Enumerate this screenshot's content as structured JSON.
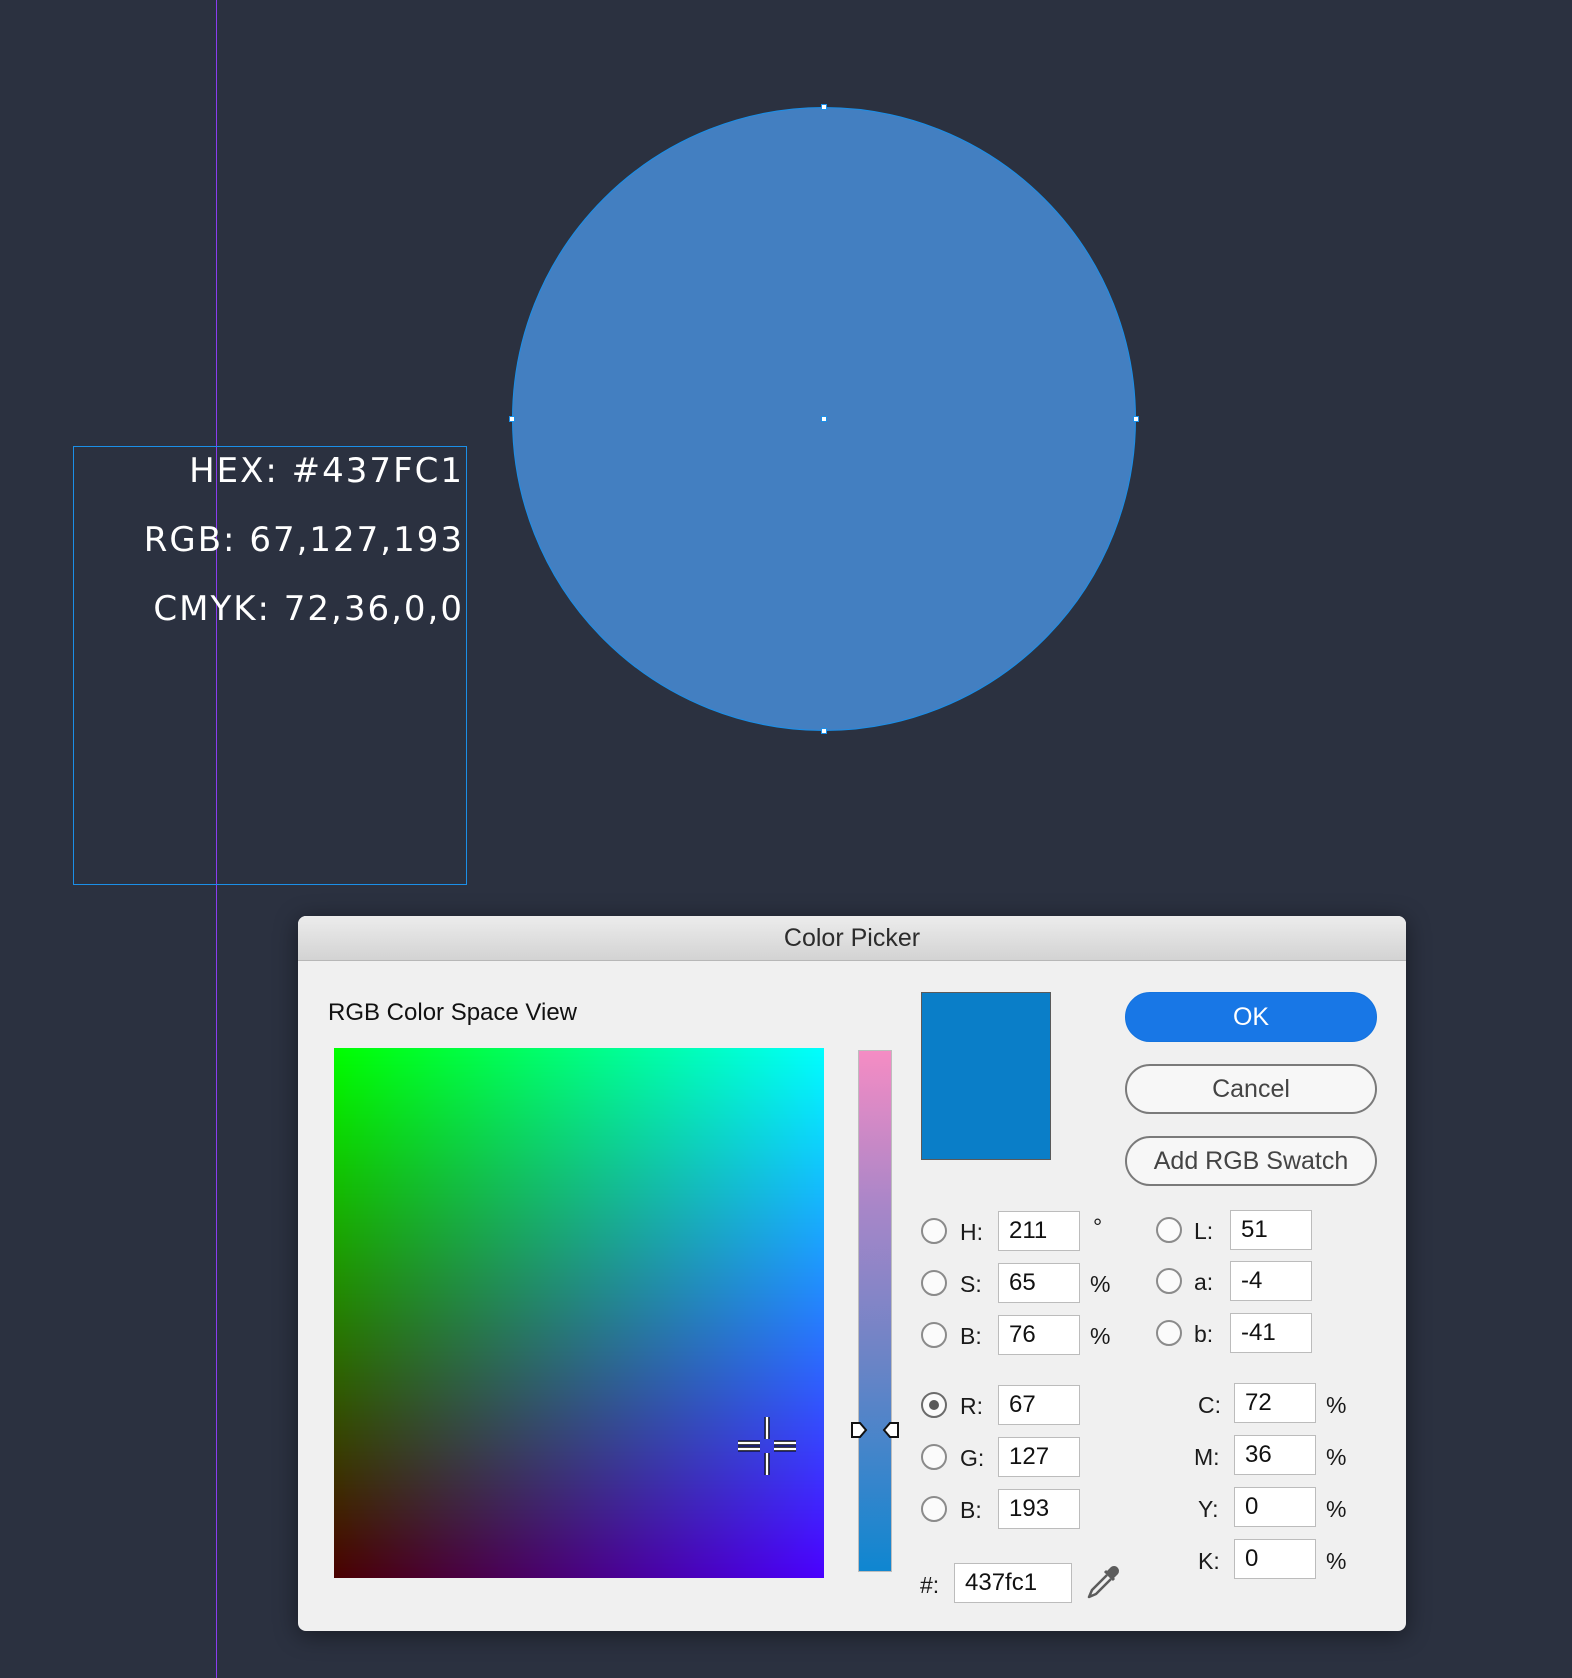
{
  "canvas": {
    "info": {
      "hex": "HEX: #437FC1",
      "rgb": "RGB: 67,127,193",
      "cmyk": "CMYK: 72,36,0,0"
    },
    "circle_color": "#437fc1",
    "guide_color": "#8a3cf0",
    "selection_color": "#1b8fe8"
  },
  "dialog": {
    "title": "Color Picker",
    "view_label": "RGB Color Space View",
    "buttons": {
      "ok": "OK",
      "cancel": "Cancel",
      "add_swatch": "Add RGB Swatch"
    },
    "swatch_color": "#0a7ec8",
    "hsb": [
      {
        "label": "H:",
        "value": "211",
        "unit": "°",
        "selected": false
      },
      {
        "label": "S:",
        "value": "65",
        "unit": "%",
        "selected": false
      },
      {
        "label": "B:",
        "value": "76",
        "unit": "%",
        "selected": false
      }
    ],
    "rgb": [
      {
        "label": "R:",
        "value": "67",
        "selected": true
      },
      {
        "label": "G:",
        "value": "127",
        "selected": false
      },
      {
        "label": "B:",
        "value": "193",
        "selected": false
      }
    ],
    "lab": [
      {
        "label": "L:",
        "value": "51"
      },
      {
        "label": "a:",
        "value": "-4"
      },
      {
        "label": "b:",
        "value": "-41"
      }
    ],
    "cmyk": [
      {
        "label": "C:",
        "value": "72",
        "unit": "%"
      },
      {
        "label": "M:",
        "value": "36",
        "unit": "%"
      },
      {
        "label": "Y:",
        "value": "0",
        "unit": "%"
      },
      {
        "label": "K:",
        "value": "0",
        "unit": "%"
      }
    ],
    "hex_label": "#:",
    "hex_value": "437fc1",
    "eyedropper_icon": "eyedropper-icon",
    "slider_position": 0.73
  }
}
